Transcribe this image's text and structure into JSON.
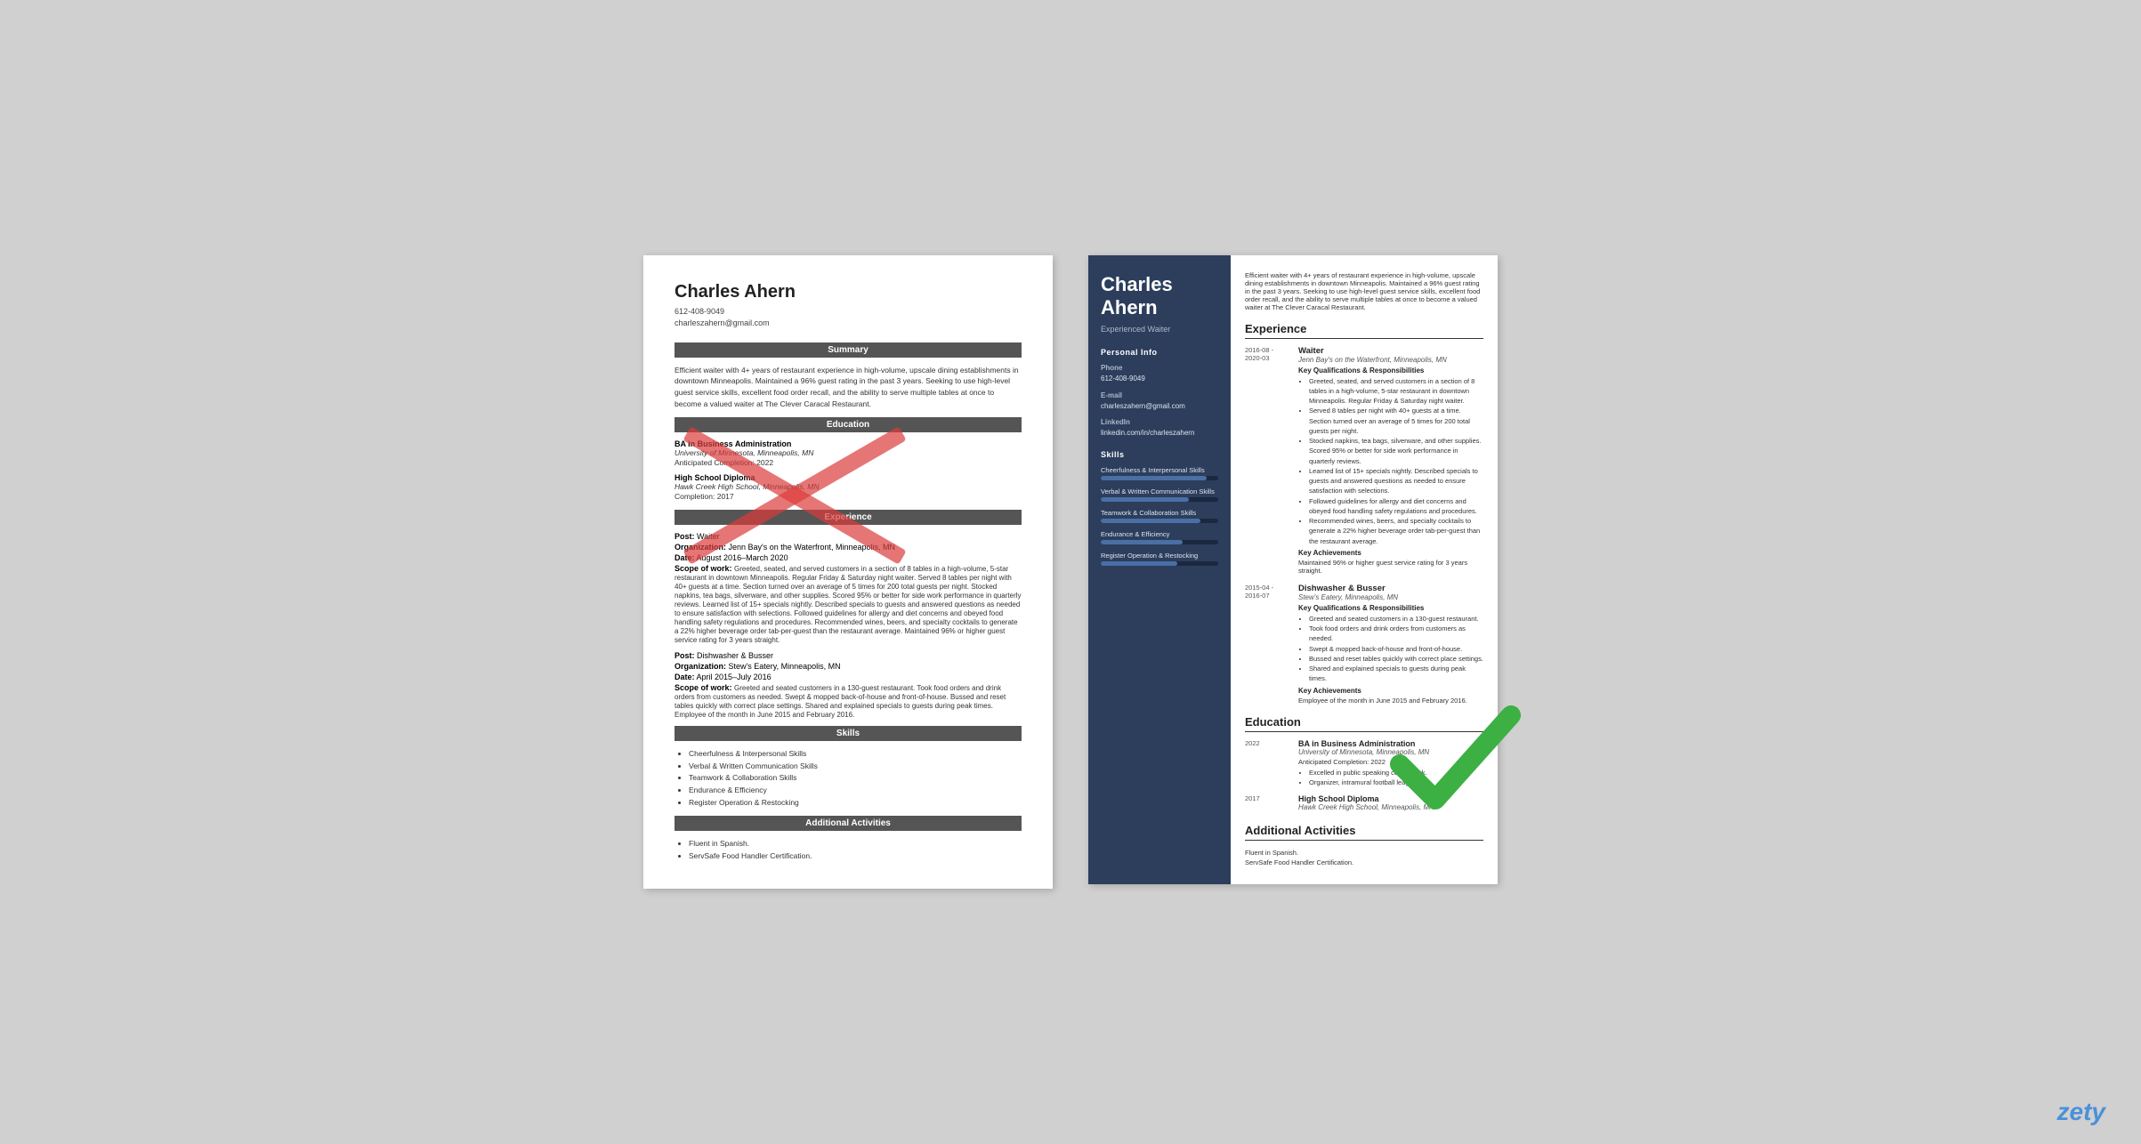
{
  "left_resume": {
    "name": "Charles Ahern",
    "phone": "612-408-9049",
    "email": "charleszahern@gmail.com",
    "sections": {
      "summary": {
        "title": "Summary",
        "text": "Efficient waiter with 4+ years of restaurant experience in high-volume, upscale dining establishments in downtown Minneapolis. Maintained a 96% guest rating in the past 3 years. Seeking to use high-level guest service skills, excellent food order recall, and the ability to serve multiple tables at once to become a valued waiter at The Clever Caracal Restaurant."
      },
      "education": {
        "title": "Education",
        "entries": [
          {
            "degree": "BA in Business Administration",
            "school": "University of Minnesota, Minneapolis, MN",
            "completion": "Anticipated Completion: 2022"
          },
          {
            "degree": "High School Diploma",
            "school": "Hawk Creek High School, Minneapolis, MN",
            "completion": "Completion: 2017"
          }
        ]
      },
      "experience": {
        "title": "Experience",
        "entries": [
          {
            "post": "Waiter",
            "org": "Jenn Bay's on the Waterfront, Minneapolis, MN",
            "date": "August 2016–March 2020",
            "scope": "Greeted, seated, and served customers in a section of 8 tables in a high-volume, 5-star restaurant in downtown Minneapolis. Regular Friday & Saturday night waiter. Served 8 tables per night with 40+ guests at a time. Section turned over an average of 5 times for 200 total guests per night. Stocked napkins, tea bags, silverware, and other supplies. Scored 95% or better for side work performance in quarterly reviews. Learned list of 15+ specials nightly. Described specials to guests and answered questions as needed to ensure satisfaction with selections. Followed guidelines for allergy and diet concerns and obeyed food handling safety regulations and procedures. Recommended wines, beers, and specialty cocktails to generate a 22% higher beverage order tab-per-guest than the restaurant average. Maintained 96% or higher guest service rating for 3 years straight."
          },
          {
            "post": "Dishwasher & Busser",
            "org": "Stew's Eatery, Minneapolis, MN",
            "date": "April 2015–July 2016",
            "scope": "Greeted and seated customers in a 130-guest restaurant. Took food orders and drink orders from customers as needed. Swept & mopped back-of-house and front-of-house. Bussed and reset tables quickly with correct place settings. Shared and explained specials to guests during peak times. Employee of the month in June 2015 and February 2016."
          }
        ]
      },
      "skills": {
        "title": "Skills",
        "items": [
          "Cheerfulness & Interpersonal Skills",
          "Verbal & Written Communication Skills",
          "Teamwork & Collaboration Skills",
          "Endurance & Efficiency",
          "Register Operation & Restocking"
        ]
      },
      "additional": {
        "title": "Additional Activities",
        "items": [
          "Fluent in Spanish.",
          "ServSafe Food Handler Certification."
        ]
      }
    }
  },
  "right_resume": {
    "name": "Charles\nAhern",
    "title": "Experienced Waiter",
    "sidebar": {
      "personal_info_title": "Personal Info",
      "phone_label": "Phone",
      "phone": "612-408-9049",
      "email_label": "E-mail",
      "email": "charleszahern@gmail.com",
      "linkedin_label": "LinkedIn",
      "linkedin": "linkedin.com/in/charleszahern",
      "skills_title": "Skills",
      "skills": [
        {
          "name": "Cheerfulness & Interpersonal Skills",
          "pct": 90
        },
        {
          "name": "Verbal & Written Communication Skills",
          "pct": 75
        },
        {
          "name": "Teamwork & Collaboration Skills",
          "pct": 85
        },
        {
          "name": "Endurance & Efficiency",
          "pct": 70
        },
        {
          "name": "Register Operation & Restocking",
          "pct": 65
        }
      ]
    },
    "summary": "Efficient waiter with 4+ years of restaurant experience in high-volume, upscale dining establishments in downtown Minneapolis. Maintained a 96% guest rating in the past 3 years. Seeking to use high-level guest service skills, excellent food order recall, and the ability to serve multiple tables at once to become a valued waiter at The Clever Caracal Restaurant.",
    "experience": {
      "title": "Experience",
      "entries": [
        {
          "date": "2016-08 -\n2020-03",
          "job_title": "Waiter",
          "company": "Jenn Bay's on the Waterfront, Minneapolis, MN",
          "key_qual_title": "Key Qualifications & Responsibilities",
          "bullets": [
            "Greeted, seated, and served customers in a section of 8 tables in a high-volume, 5-star restaurant in downtown Minneapolis. Regular Friday & Saturday night waiter.",
            "Served 8 tables per night with 40+ guests at a time. Section turned over an average of 5 times for 200 total guests per night.",
            "Stocked napkins, tea bags, silverware, and other supplies. Scored 95% or better for side work performance in quarterly reviews.",
            "Learned list of 15+ specials nightly. Described specials to guests and answered questions as needed to ensure satisfaction with selections.",
            "Followed guidelines for allergy and diet concerns and obeyed food handling safety regulations and procedures.",
            "Recommended wines, beers, and specialty cocktails to generate a 22% higher beverage order tab-per-guest than the restaurant average."
          ],
          "achievements_title": "Key Achievements",
          "achievements": "Maintained 96% or higher guest service rating for 3 years straight."
        },
        {
          "date": "2015-04 -\n2016-07",
          "job_title": "Dishwasher & Busser",
          "company": "Stew's Eatery, Minneapolis, MN",
          "key_qual_title": "Key Qualifications & Responsibilities",
          "bullets": [
            "Greeted and seated customers in a 130-guest restaurant.",
            "Took food orders and drink orders from customers as needed.",
            "Swept & mopped back-of-house and front-of-house.",
            "Bussed and reset tables quickly with correct place settings.",
            "Shared and explained specials to guests during peak times."
          ],
          "achievements_title": "Key Achievements",
          "achievements": "Employee of the month in June 2015 and February 2016."
        }
      ]
    },
    "education": {
      "title": "Education",
      "entries": [
        {
          "date": "2022",
          "degree": "BA in Business Administration",
          "school": "University of Minnesota, Minneapolis, MN",
          "completion": "Anticipated Completion: 2022",
          "bullets": [
            "Excelled in public speaking coursework.",
            "Organizer, intramural football league."
          ]
        },
        {
          "date": "2017",
          "degree": "High School Diploma",
          "school": "Hawk Creek High School, Minneapolis, MN"
        }
      ]
    },
    "additional": {
      "title": "Additional Activities",
      "items": [
        "Fluent in Spanish.",
        "ServSafe Food Handler Certification."
      ]
    }
  },
  "zety": "zety"
}
